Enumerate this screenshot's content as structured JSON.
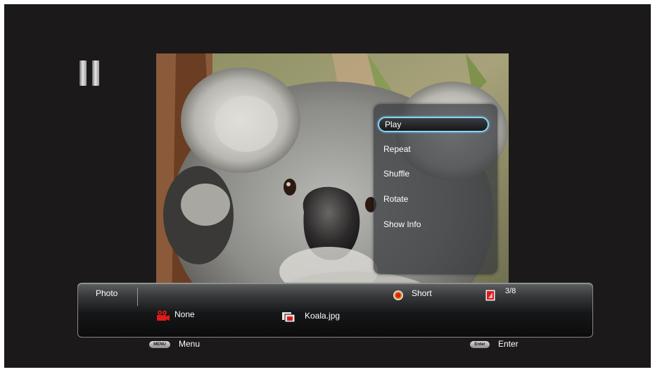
{
  "menu": {
    "items": [
      {
        "label": "Play",
        "selected": true
      },
      {
        "label": "Repeat"
      },
      {
        "label": "Shuffle"
      },
      {
        "label": "Rotate"
      },
      {
        "label": "Show Info"
      }
    ]
  },
  "info_bar": {
    "category": "Photo",
    "music_label": "None",
    "speed_label": "Short",
    "counter": "3/8",
    "file_name": "Koala.jpg",
    "icons": {
      "music": "film-camera-icon",
      "speed": "speed-dial-icon",
      "counter": "photo-count-icon",
      "file": "photo-file-icon"
    }
  },
  "status": {
    "playback_icon": "pause-icon"
  },
  "hints": {
    "menu": {
      "key": "MENU",
      "label": "Menu"
    },
    "enter": {
      "key": "Enter",
      "label": "Enter"
    }
  },
  "colors": {
    "selection_outline": "#8fd0f4",
    "background": "#1b1919",
    "icon_red": "#e01a1a"
  }
}
